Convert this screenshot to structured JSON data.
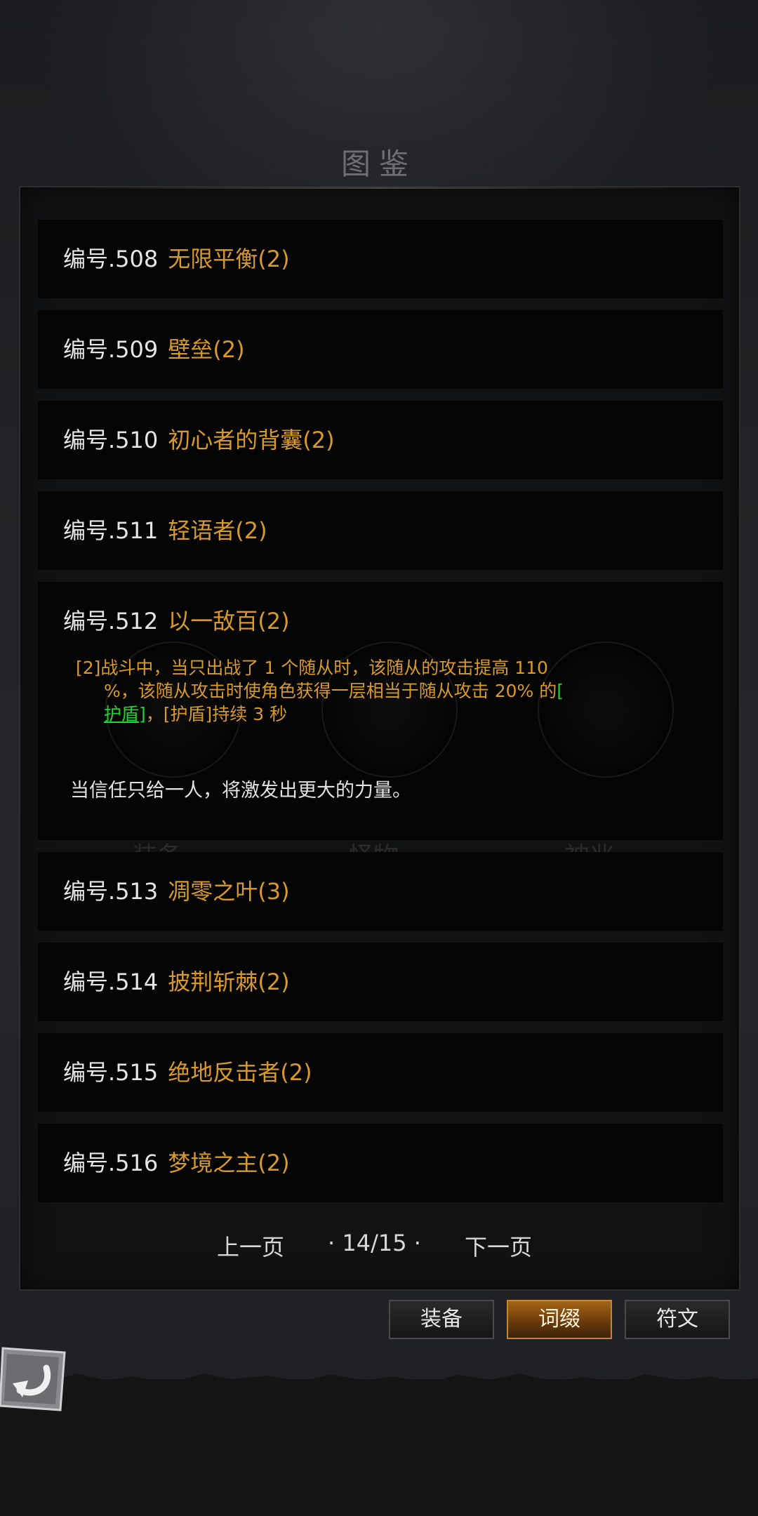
{
  "title": "图鉴",
  "entries": [
    {
      "number": "编号.508",
      "name": "无限平衡(2)"
    },
    {
      "number": "编号.509",
      "name": "壁垒(2)"
    },
    {
      "number": "编号.510",
      "name": "初心者的背囊(2)"
    },
    {
      "number": "编号.511",
      "name": "轻语者(2)"
    },
    {
      "number": "编号.512",
      "name": "以一敌百(2)",
      "desc_tag": "[2]",
      "desc_line1": "战斗中，当只出战了 1 个随从时，该随从的攻击提高 110",
      "desc_line2a": "%，该随从攻击时使角色获得一层相当于随从攻击 20% 的",
      "desc_bracket_open": "[",
      "desc_link": "护盾",
      "desc_bracket_close": "]",
      "desc_line3b": "，[护盾]持续 3 秒",
      "flavor": "当信任只给一人，将激发出更大的力量。"
    },
    {
      "number": "编号.513",
      "name": "凋零之叶(3)"
    },
    {
      "number": "编号.514",
      "name": "披荆斩棘(2)"
    },
    {
      "number": "编号.515",
      "name": "绝地反击者(2)"
    },
    {
      "number": "编号.516",
      "name": "梦境之主(2)"
    }
  ],
  "background_labels": [
    "装备",
    "怪物",
    "神兆"
  ],
  "pager": {
    "prev": "上一页",
    "page": "· 14/15 ·",
    "next": "下一页"
  },
  "tabs": [
    {
      "label": "装备",
      "active": false
    },
    {
      "label": "词缀",
      "active": true
    },
    {
      "label": "符文",
      "active": false
    }
  ],
  "colors": {
    "entry_name": "#d79a2a",
    "entry_number": "#e6e6e6",
    "link_green": "#1fd62a",
    "active_tab": "#a36516"
  },
  "icons": {
    "back": "back-arrow-icon"
  }
}
